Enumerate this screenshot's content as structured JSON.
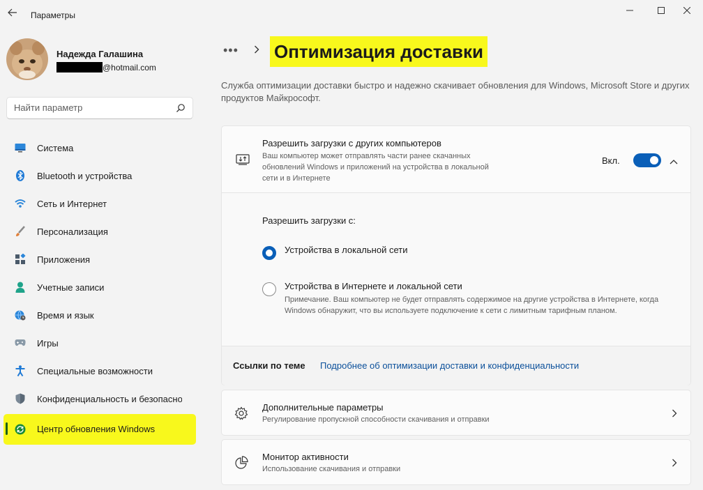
{
  "window": {
    "title": "Параметры",
    "back_icon": "back-arrow-icon",
    "controls": [
      "minimize-icon",
      "maximize-icon",
      "close-icon"
    ]
  },
  "profile": {
    "name": "Надежда Галашина",
    "email_domain": "@hotmail.com"
  },
  "search": {
    "placeholder": "Найти параметр",
    "icon": "search-icon"
  },
  "sidebar": {
    "items": [
      {
        "label": "Система",
        "icon": "system-display-icon"
      },
      {
        "label": "Bluetooth и устройства",
        "icon": "bluetooth-icon"
      },
      {
        "label": "Сеть и Интернет",
        "icon": "wifi-icon"
      },
      {
        "label": "Персонализация",
        "icon": "brush-icon"
      },
      {
        "label": "Приложения",
        "icon": "apps-icon"
      },
      {
        "label": "Учетные записи",
        "icon": "account-icon"
      },
      {
        "label": "Время и язык",
        "icon": "globe-clock-icon"
      },
      {
        "label": "Игры",
        "icon": "gamepad-icon"
      },
      {
        "label": "Специальные возможности",
        "icon": "accessibility-icon"
      },
      {
        "label": "Конфиденциальность и безопасность",
        "icon": "shield-icon"
      },
      {
        "label": "Центр обновления Windows",
        "icon": "windows-update-icon",
        "active": true
      }
    ]
  },
  "header": {
    "breadcrumb_more": "•••",
    "title": "Оптимизация доставки",
    "description": "Служба оптимизации доставки быстро и надежно скачивает обновления для Windows, Microsoft Store и других продуктов Майкрософт."
  },
  "allow_downloads": {
    "title": "Разрешить загрузки с других компьютеров",
    "description": "Ваш компьютер может отправлять части ранее скачанных обновлений Windows и приложений на устройства в локальной сети и в Интернете",
    "state_label": "Вкл.",
    "enabled": true,
    "radio_group_label": "Разрешить загрузки с:",
    "options": [
      {
        "label": "Устройства в локальной сети",
        "selected": true
      },
      {
        "label": "Устройства в Интернете и локальной сети",
        "note": "Примечание. Ваш компьютер не будет отправлять содержимое на другие устройства в Интернете, когда Windows обнаружит, что вы используете подключение к сети с лимитным тарифным планом.",
        "selected": false
      }
    ]
  },
  "related_links": {
    "label": "Ссылки по теме",
    "link": "Подробнее об оптимизации доставки и конфиденциальности"
  },
  "advanced": {
    "title": "Дополнительные параметры",
    "subtitle": "Регулирование пропускной способности скачивания и отправки",
    "icon": "gear-icon"
  },
  "activity": {
    "title": "Монитор активности",
    "subtitle": "Использование скачивания и отправки",
    "icon": "pie-chart-icon"
  },
  "colors": {
    "accent": "#0a5fb8",
    "highlight": "#f8f81c",
    "background": "#f3f3f3"
  }
}
